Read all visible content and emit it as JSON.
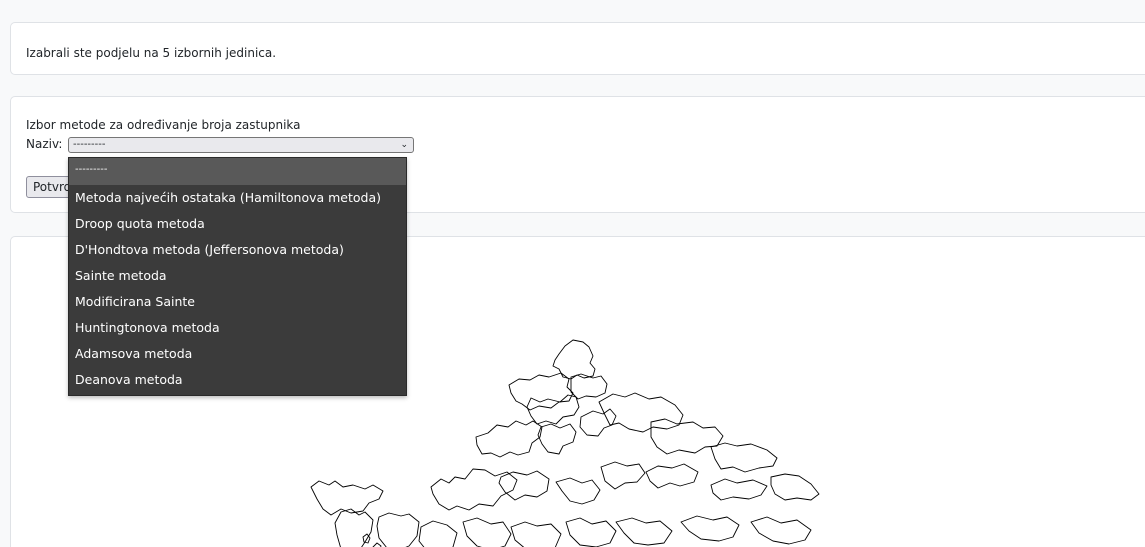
{
  "info_card": {
    "text": "Izabrali ste podjelu na 5 izbornih jedinica."
  },
  "method_card": {
    "title": "Izbor metode za određivanje broja zastupnika",
    "naziv_label": "Naziv:",
    "select_value": "---------",
    "confirm_label": "Potvrdi"
  },
  "dropdown": {
    "options": [
      "---------",
      "Metoda najvećih ostataka (Hamiltonova metoda)",
      "Droop quota metoda",
      "D'Hondtova metoda (Jeffersonova metoda)",
      "Sainte metoda",
      "Modificirana Sainte",
      "Huntingtonova metoda",
      "Adamsova metoda",
      "Deanova metoda"
    ],
    "selected_index": 0
  },
  "icons": {
    "select_chevron": "chevron-down-icon"
  },
  "colors": {
    "dropdown_bg": "#3b3b3b",
    "dropdown_selected_bg": "#595959",
    "card_border": "#dfe2e6"
  }
}
